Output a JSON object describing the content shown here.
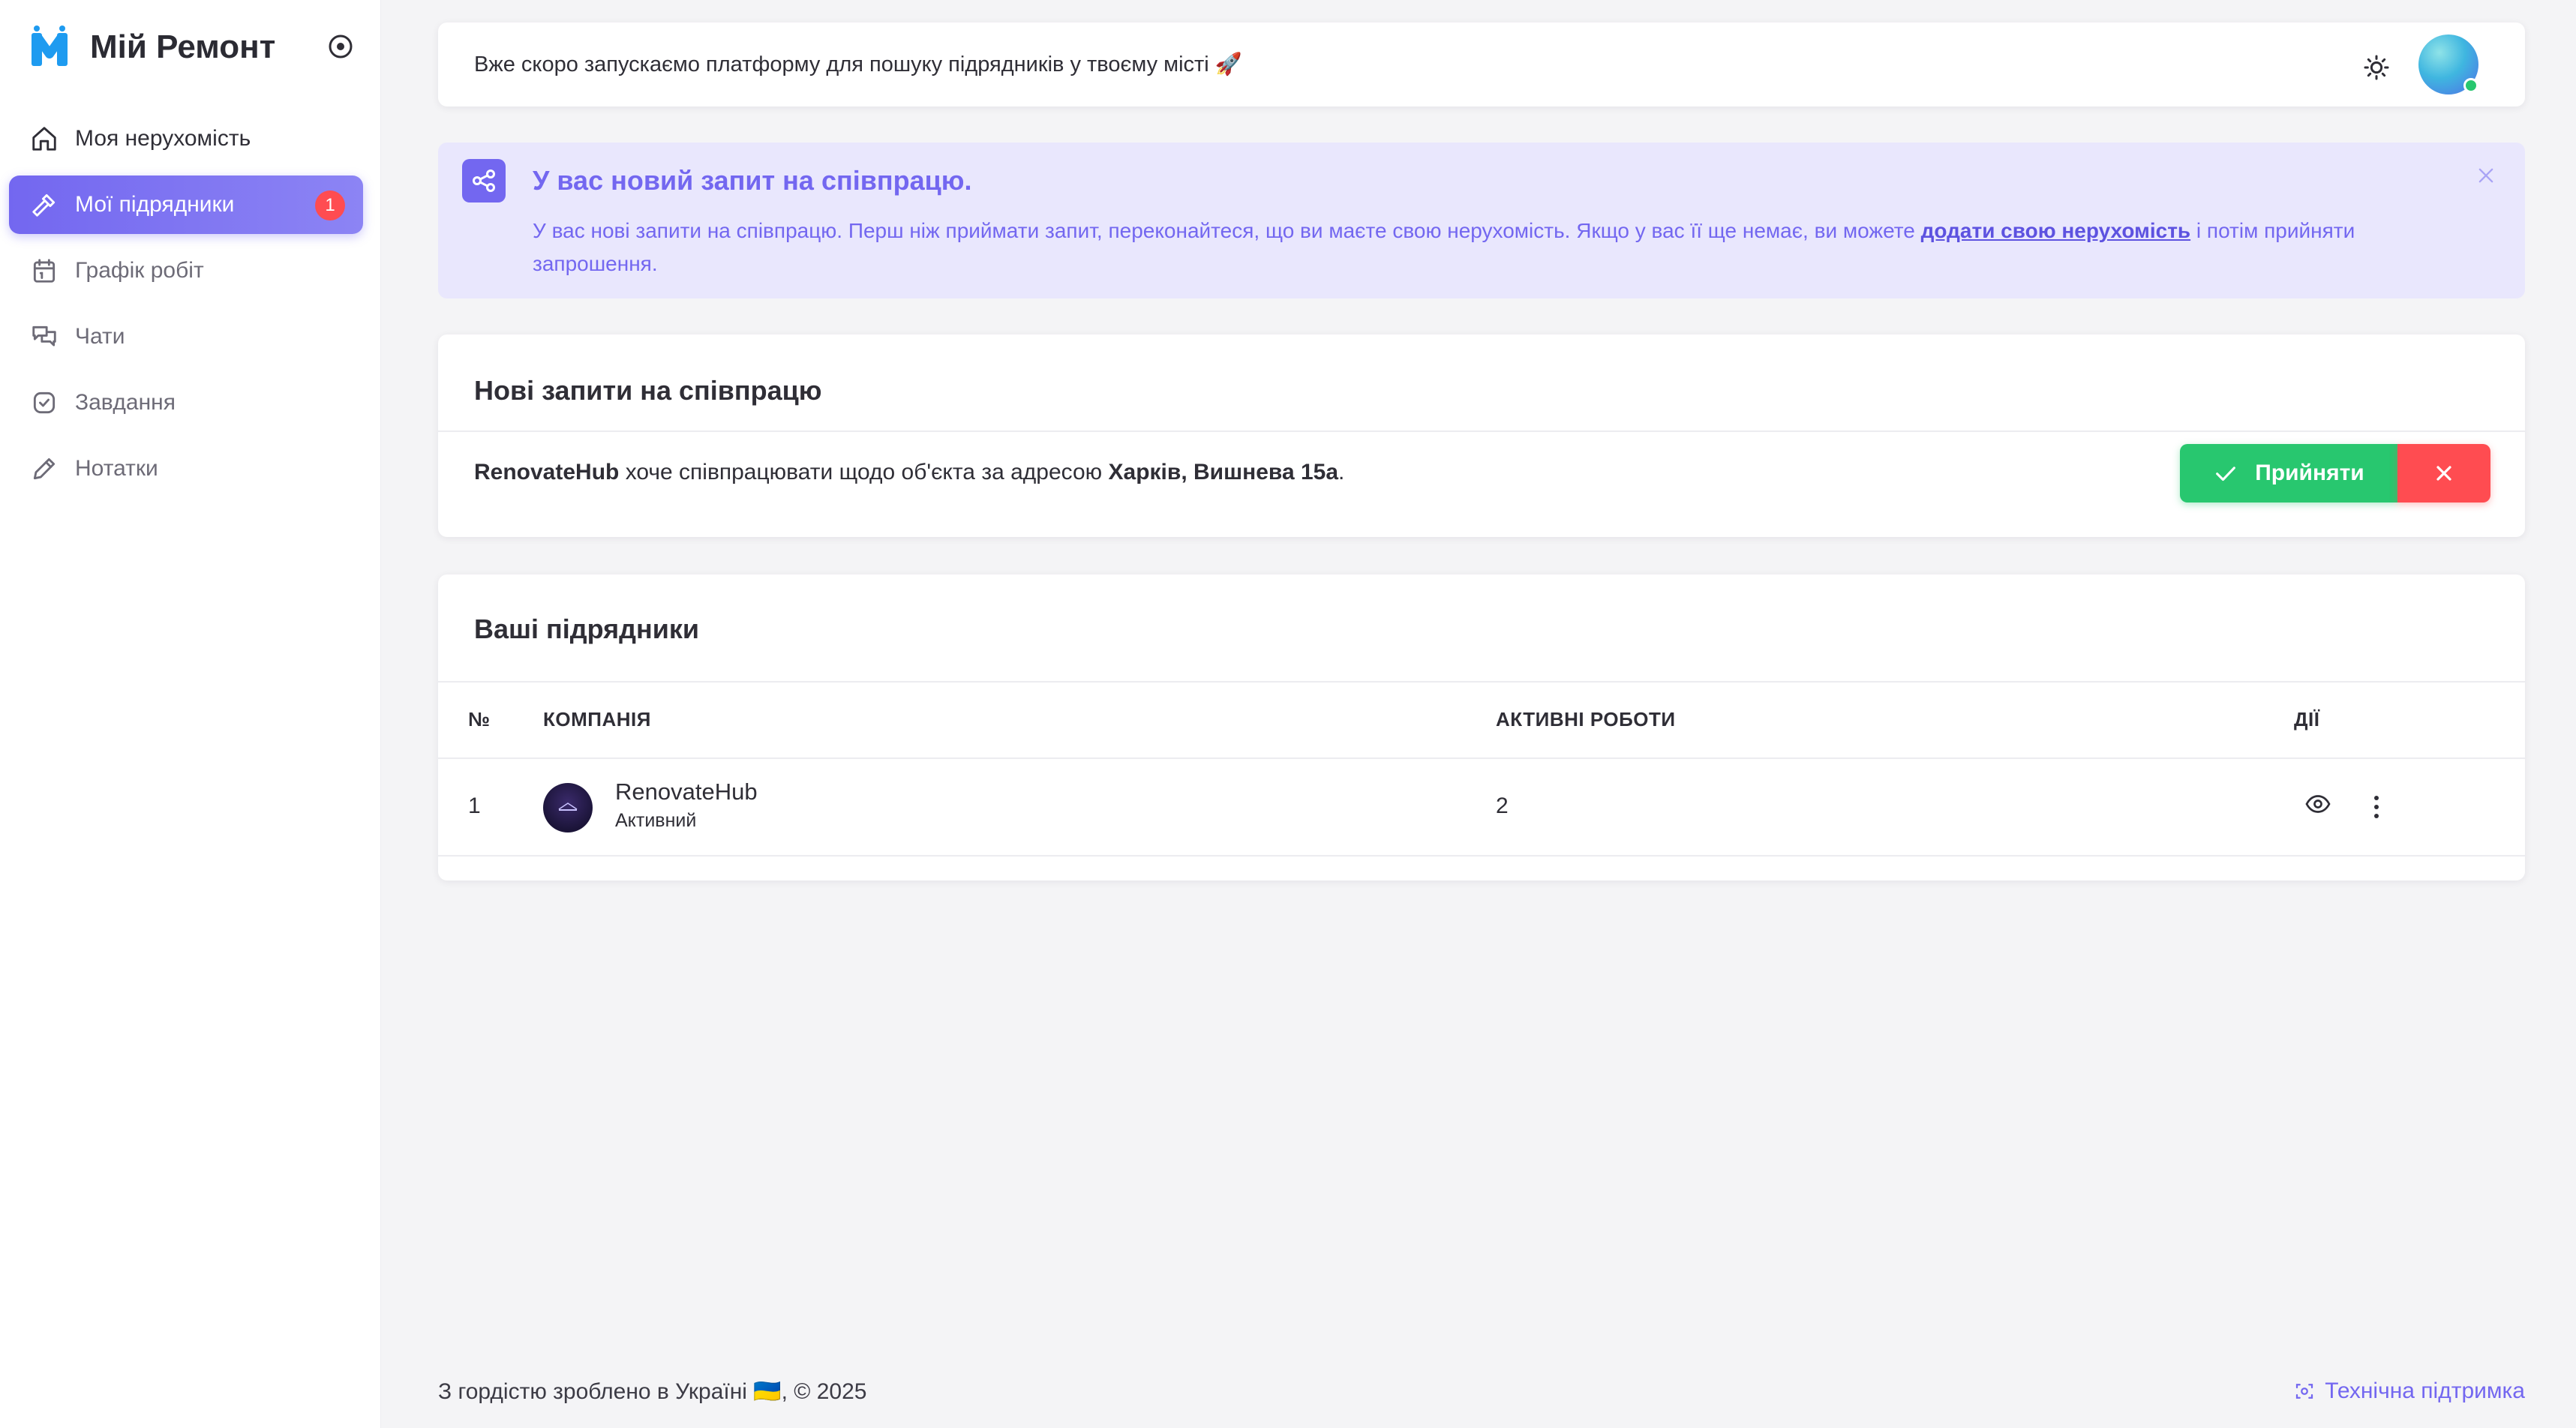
{
  "app": {
    "name": "Мій Ремонт",
    "accent_color": "#7367f0"
  },
  "sidebar": {
    "items": [
      {
        "label": "Моя нерухомість",
        "icon": "home-icon"
      },
      {
        "label": "Мої підрядники",
        "icon": "hammer-icon",
        "badge": "1",
        "active": true
      },
      {
        "label": "Графік робіт",
        "icon": "calendar-icon"
      },
      {
        "label": "Чати",
        "icon": "chat-icon"
      },
      {
        "label": "Завдання",
        "icon": "task-check-icon"
      },
      {
        "label": "Нотатки",
        "icon": "pencil-icon"
      }
    ]
  },
  "topbar": {
    "announcement": "Вже скоро запускаємо платформу для пошуку підрядників у твоєму місті 🚀"
  },
  "alert": {
    "title": "У вас новий запит на співпрацю.",
    "text_before": "У вас нові запити на співпрацю. Перш ніж приймати запит, переконайтеся, що ви маєте свою нерухомість. Якщо у вас її ще немає, ви можете ",
    "link_text": "додати свою нерухомість",
    "text_after": " і потім прийняти запрошення."
  },
  "requests": {
    "title": "Нові запити на співпрацю",
    "company": "RenovateHub",
    "text_middle": " хоче співпрацювати щодо об'єкта за адресою ",
    "address": "Харків, Вишнева 15а",
    "text_end": ".",
    "accept_label": "Прийняти"
  },
  "contractors": {
    "title": "Ваші підрядники",
    "columns": {
      "number": "№",
      "company": "КОМПАНІЯ",
      "active_jobs": "АКТИВНІ РОБОТИ",
      "actions": "ДІЇ"
    },
    "rows": [
      {
        "number": "1",
        "company": "RenovateHub",
        "status": "Активний",
        "active_jobs": "2"
      }
    ]
  },
  "footer": {
    "left": "З гордістю зроблено в Україні 🇺🇦, © 2025",
    "support": "Технічна підтримка"
  }
}
